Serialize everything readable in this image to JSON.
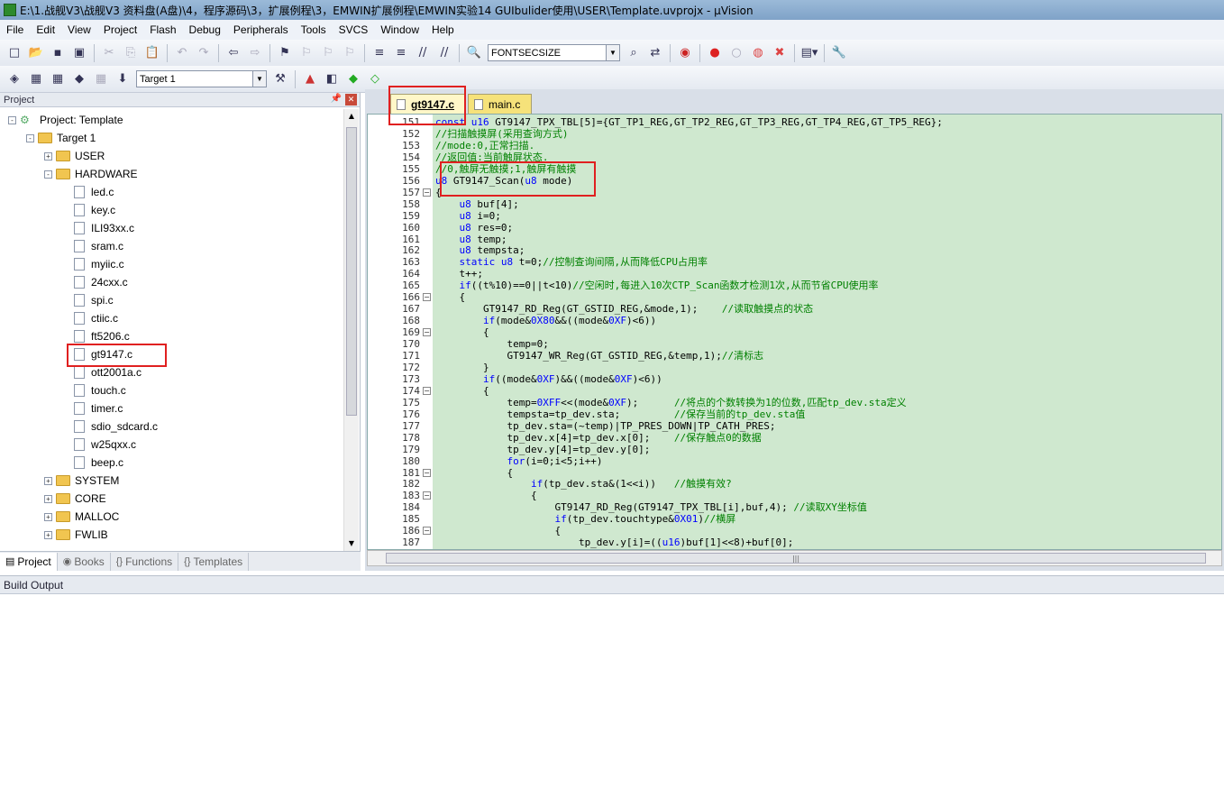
{
  "window": {
    "title": "E:\\1.战舰V3\\战舰V3 资料盘(A盘)\\4，程序源码\\3，扩展例程\\3，EMWIN扩展例程\\EMWIN实验14 GUIbulider使用\\USER\\Template.uvprojx - µVision"
  },
  "menu": [
    "File",
    "Edit",
    "View",
    "Project",
    "Flash",
    "Debug",
    "Peripherals",
    "Tools",
    "SVCS",
    "Window",
    "Help"
  ],
  "toolbar": {
    "find_combo": "FONTSECSIZE",
    "target_combo": "Target 1"
  },
  "project_panel": {
    "title": "Project",
    "root": "Project: Template",
    "target": "Target 1",
    "groups_top": [
      "USER",
      "HARDWARE"
    ],
    "hardware_files": [
      "led.c",
      "key.c",
      "ILI93xx.c",
      "sram.c",
      "myiic.c",
      "24cxx.c",
      "spi.c",
      "ctiic.c",
      "ft5206.c",
      "gt9147.c",
      "ott2001a.c",
      "touch.c",
      "timer.c",
      "sdio_sdcard.c",
      "w25qxx.c",
      "beep.c"
    ],
    "groups_bottom": [
      "SYSTEM",
      "CORE",
      "MALLOC",
      "FWLIB"
    ],
    "tabs": [
      "Project",
      "Books",
      "Functions",
      "Templates"
    ]
  },
  "editor": {
    "tabs": [
      "gt9147.c",
      "main.c"
    ],
    "lines": [
      {
        "n": 151,
        "fold": "",
        "segs": [
          [
            "kw",
            "const u16 "
          ],
          [
            "",
            "GT9147_TPX_TBL[5]={GT_TP1_REG,GT_TP2_REG,GT_TP3_REG,GT_TP4_REG,GT_TP5_REG};"
          ]
        ]
      },
      {
        "n": 152,
        "fold": "",
        "segs": [
          [
            "cm",
            "//扫描触摸屏(采用查询方式)"
          ]
        ]
      },
      {
        "n": 153,
        "fold": "",
        "segs": [
          [
            "cm",
            "//mode:0,正常扫描."
          ]
        ]
      },
      {
        "n": 154,
        "fold": "",
        "segs": [
          [
            "cm",
            "//返回值:当前触屏状态."
          ]
        ]
      },
      {
        "n": 155,
        "fold": "",
        "segs": [
          [
            "cm",
            "//0,触屏无触摸;1,触屏有触摸"
          ]
        ]
      },
      {
        "n": 156,
        "fold": "",
        "segs": [
          [
            "kw",
            "u8 "
          ],
          [
            "",
            "GT9147_Scan("
          ],
          [
            "kw",
            "u8 "
          ],
          [
            "",
            "mode)"
          ]
        ]
      },
      {
        "n": 157,
        "fold": "-",
        "segs": [
          [
            "",
            "{"
          ]
        ]
      },
      {
        "n": 158,
        "fold": "",
        "segs": [
          [
            "",
            "    "
          ],
          [
            "kw",
            "u8 "
          ],
          [
            "",
            "buf[4];"
          ]
        ]
      },
      {
        "n": 159,
        "fold": "",
        "segs": [
          [
            "",
            "    "
          ],
          [
            "kw",
            "u8 "
          ],
          [
            "",
            "i=0;"
          ]
        ]
      },
      {
        "n": 160,
        "fold": "",
        "segs": [
          [
            "",
            "    "
          ],
          [
            "kw",
            "u8 "
          ],
          [
            "",
            "res=0;"
          ]
        ]
      },
      {
        "n": 161,
        "fold": "",
        "segs": [
          [
            "",
            "    "
          ],
          [
            "kw",
            "u8 "
          ],
          [
            "",
            "temp;"
          ]
        ]
      },
      {
        "n": 162,
        "fold": "",
        "segs": [
          [
            "",
            "    "
          ],
          [
            "kw",
            "u8 "
          ],
          [
            "",
            "tempsta;"
          ]
        ]
      },
      {
        "n": 163,
        "fold": "",
        "segs": [
          [
            "",
            "    "
          ],
          [
            "kw",
            "static u8 "
          ],
          [
            "",
            "t=0;"
          ],
          [
            "cm",
            "//控制查询间隔,从而降低CPU占用率"
          ]
        ]
      },
      {
        "n": 164,
        "fold": "",
        "segs": [
          [
            "",
            "    t++;"
          ]
        ]
      },
      {
        "n": 165,
        "fold": "",
        "segs": [
          [
            "",
            "    "
          ],
          [
            "kw",
            "if"
          ],
          [
            "",
            "((t%10)==0||t<10)"
          ],
          [
            "cm",
            "//空闲时,每进入10次CTP_Scan函数才检测1次,从而节省CPU使用率"
          ]
        ]
      },
      {
        "n": 166,
        "fold": "-",
        "segs": [
          [
            "",
            "    {"
          ]
        ]
      },
      {
        "n": 167,
        "fold": "",
        "segs": [
          [
            "",
            "        GT9147_RD_Reg(GT_GSTID_REG,&mode,1);    "
          ],
          [
            "cm",
            "//读取触摸点的状态"
          ]
        ]
      },
      {
        "n": 168,
        "fold": "",
        "segs": [
          [
            "",
            "        "
          ],
          [
            "kw",
            "if"
          ],
          [
            "",
            "(mode&"
          ],
          [
            "nm",
            "0X80"
          ],
          [
            "",
            "&&((mode&"
          ],
          [
            "nm",
            "0XF"
          ],
          [
            "",
            ")<6))"
          ]
        ]
      },
      {
        "n": 169,
        "fold": "-",
        "segs": [
          [
            "",
            "        {"
          ]
        ]
      },
      {
        "n": 170,
        "fold": "",
        "segs": [
          [
            "",
            "            temp=0;"
          ]
        ]
      },
      {
        "n": 171,
        "fold": "",
        "segs": [
          [
            "",
            "            GT9147_WR_Reg(GT_GSTID_REG,&temp,1);"
          ],
          [
            "cm",
            "//清标志"
          ]
        ]
      },
      {
        "n": 172,
        "fold": "",
        "segs": [
          [
            "",
            "        }"
          ]
        ]
      },
      {
        "n": 173,
        "fold": "",
        "segs": [
          [
            "",
            "        "
          ],
          [
            "kw",
            "if"
          ],
          [
            "",
            "((mode&"
          ],
          [
            "nm",
            "0XF"
          ],
          [
            "",
            ")&&((mode&"
          ],
          [
            "nm",
            "0XF"
          ],
          [
            "",
            ")<6))"
          ]
        ]
      },
      {
        "n": 174,
        "fold": "-",
        "segs": [
          [
            "",
            "        {"
          ]
        ]
      },
      {
        "n": 175,
        "fold": "",
        "segs": [
          [
            "",
            "            temp="
          ],
          [
            "nm",
            "0XFF"
          ],
          [
            "",
            "<<(mode&"
          ],
          [
            "nm",
            "0XF"
          ],
          [
            "",
            ");      "
          ],
          [
            "cm",
            "//将点的个数转换为1的位数,匹配tp_dev.sta定义"
          ]
        ]
      },
      {
        "n": 176,
        "fold": "",
        "segs": [
          [
            "",
            "            tempsta=tp_dev.sta;         "
          ],
          [
            "cm",
            "//保存当前的tp_dev.sta值"
          ]
        ]
      },
      {
        "n": 177,
        "fold": "",
        "segs": [
          [
            "",
            "            tp_dev.sta=(~temp)|TP_PRES_DOWN|TP_CATH_PRES;"
          ]
        ]
      },
      {
        "n": 178,
        "fold": "",
        "segs": [
          [
            "",
            "            tp_dev.x[4]=tp_dev.x[0];    "
          ],
          [
            "cm",
            "//保存触点0的数据"
          ]
        ]
      },
      {
        "n": 179,
        "fold": "",
        "segs": [
          [
            "",
            "            tp_dev.y[4]=tp_dev.y[0];"
          ]
        ]
      },
      {
        "n": 180,
        "fold": "",
        "segs": [
          [
            "",
            "            "
          ],
          [
            "kw",
            "for"
          ],
          [
            "",
            "(i=0;i<5;i++)"
          ]
        ]
      },
      {
        "n": 181,
        "fold": "-",
        "segs": [
          [
            "",
            "            {"
          ]
        ]
      },
      {
        "n": 182,
        "fold": "",
        "segs": [
          [
            "",
            "                "
          ],
          [
            "kw",
            "if"
          ],
          [
            "",
            "(tp_dev.sta&(1<<i))   "
          ],
          [
            "cm",
            "//触摸有效?"
          ]
        ]
      },
      {
        "n": 183,
        "fold": "-",
        "segs": [
          [
            "",
            "                {"
          ]
        ]
      },
      {
        "n": 184,
        "fold": "",
        "segs": [
          [
            "",
            "                    GT9147_RD_Reg(GT9147_TPX_TBL[i],buf,4); "
          ],
          [
            "cm",
            "//读取XY坐标值"
          ]
        ]
      },
      {
        "n": 185,
        "fold": "",
        "segs": [
          [
            "",
            "                    "
          ],
          [
            "kw",
            "if"
          ],
          [
            "",
            "(tp_dev.touchtype&"
          ],
          [
            "nm",
            "0X01"
          ],
          [
            "",
            ")"
          ],
          [
            "cm",
            "//横屏"
          ]
        ]
      },
      {
        "n": 186,
        "fold": "-",
        "segs": [
          [
            "",
            "                    {"
          ]
        ]
      },
      {
        "n": 187,
        "fold": "",
        "segs": [
          [
            "",
            "                        tp_dev.y[i]=(("
          ],
          [
            "kw",
            "u16"
          ],
          [
            "",
            ")buf[1]<<8)+buf[0];"
          ]
        ]
      }
    ]
  },
  "build_output": {
    "title": "Build Output"
  }
}
